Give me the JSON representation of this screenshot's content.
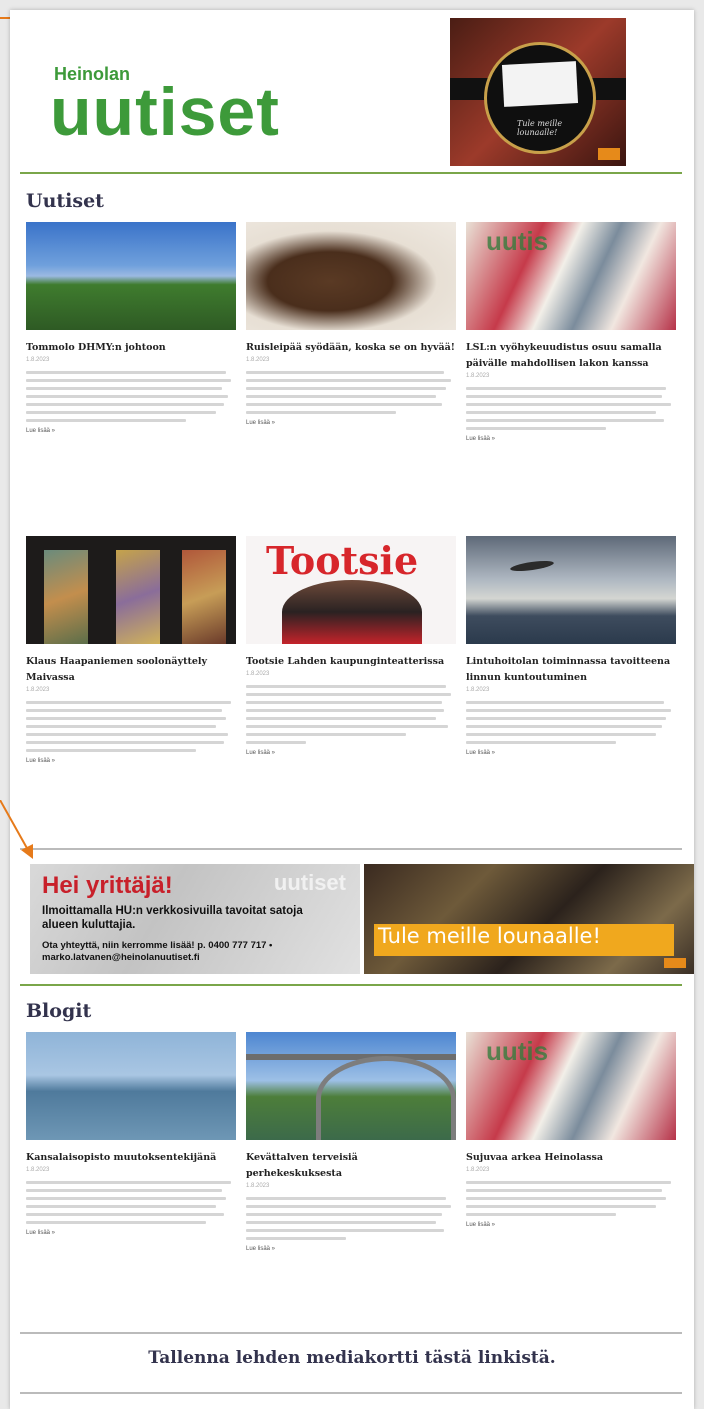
{
  "header": {
    "logo_small": "Heinolan",
    "logo_big": "uutiset",
    "ad_top_text": "Tule meille lounaalle!"
  },
  "sections": {
    "news_title": "Uutiset",
    "blogs_title": "Blogit"
  },
  "news": [
    {
      "title": "Tommolo DHMY:n johtoon",
      "date": "1.8.2023",
      "more": "Lue lisää »",
      "image": "town-aerial"
    },
    {
      "title": "Ruisleipää syödään, koska se on hyvää!",
      "date": "1.8.2023",
      "more": "Lue lisää »",
      "image": "rye-bread"
    },
    {
      "title": "LSL:n vyöhykeuudistus osuu samalla päivälle mahdollisen lakon kanssa",
      "date": "1.8.2023",
      "more": "Lue lisää »",
      "image": "newspaper-stack"
    },
    {
      "title": "Klaus Haapaniemen soolonäyttely Maivassa",
      "date": "1.8.2023",
      "more": "Lue lisää »",
      "image": "art-gallery"
    },
    {
      "title": "Tootsie Lahden kaupunginteatterissa",
      "date": "1.8.2023",
      "more": "Lue lisää »",
      "image": "tootsie"
    },
    {
      "title": "Lintuhoitolan toiminnassa tavoitteena linnun kuntoutuminen",
      "date": "1.8.2023",
      "more": "Lue lisää »",
      "image": "bird-sky"
    }
  ],
  "ads": {
    "hei_title": "Hei yrittäjä!",
    "hei_watermark": "uutiset",
    "hei_line1": "Ilmoittamalla HU:n verkkosivuilla tavoitat satoja alueen kuluttajia.",
    "hei_line2": "Ota yhteyttä, niin kerromme lisää! p. 0400 777 717 • marko.latvanen@heinolanuutiset.fi",
    "food_text": "Tule meille lounaalle!"
  },
  "blogs": [
    {
      "title": "Kansalaisopisto muutoksentekijänä",
      "date": "1.8.2023",
      "more": "Lue lisää »",
      "image": "lake"
    },
    {
      "title": "Kevättalven terveisiä perhekeskuksesta",
      "date": "1.8.2023",
      "more": "Lue lisää »",
      "image": "bridge"
    },
    {
      "title": "Sujuvaa arkea Heinolassa",
      "date": "1.8.2023",
      "more": "Lue lisää »",
      "image": "newspaper-stack"
    }
  ],
  "footer": {
    "mediakortti_link": "Tallenna lehden mediakortti tästä linkistä."
  },
  "colors": {
    "brand_green": "#3d9a3a",
    "accent_orange": "#e67a1a",
    "heading_navy": "#33334d",
    "ad_red": "#c8202a"
  }
}
